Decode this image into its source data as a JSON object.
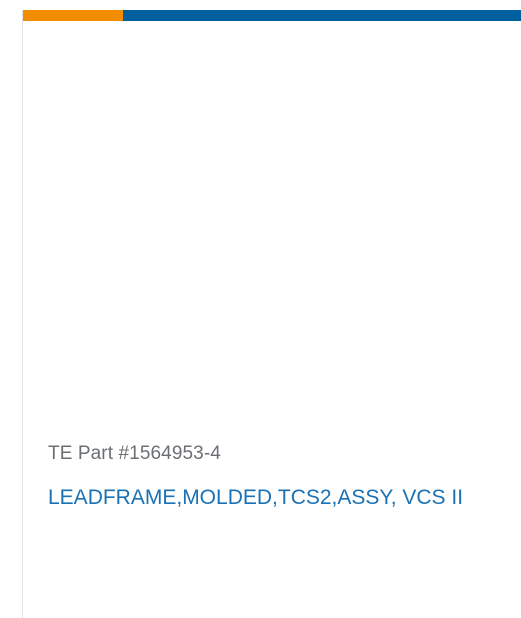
{
  "colors": {
    "accent_orange": "#f28c00",
    "accent_blue": "#005f9e",
    "link_blue": "#1a72b4",
    "muted_text": "#6b6f73"
  },
  "product": {
    "part_number": "TE Part #1564953-4",
    "description": "LEADFRAME,MOLDED,TCS2,ASSY, VCS II"
  }
}
